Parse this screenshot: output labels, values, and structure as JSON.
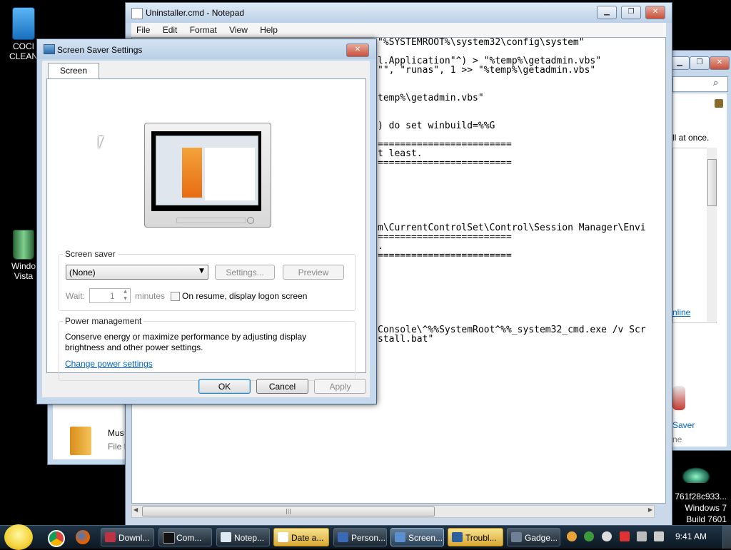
{
  "desktop": {
    "ccleaner_label_1": "COCI",
    "ccleaner_label_2": "CLEAN",
    "bin_label_1": "Windo",
    "bin_label_2": "Vista",
    "watermark_hash": "761f28c933...",
    "watermark_os": "Windows 7",
    "watermark_build": "Build 7601"
  },
  "notepad": {
    "title": "Uninstaller.cmd - Notepad",
    "menu": [
      "File",
      "Edit",
      "Format",
      "View",
      "Help"
    ],
    "lines": [
      "\"%SYSTEMROOT%\\system32\\config\\system\"",
      "",
      "l.Application\"^) > \"%temp%\\getadmin.vbs\"",
      "\"\", \"runas\", 1 >> \"%temp%\\getadmin.vbs\"",
      "",
      "",
      "temp%\\getadmin.vbs\"",
      "",
      "",
      ") do set winbuild=%%G",
      "",
      "========================",
      "t least.",
      "========================",
      "",
      "",
      "",
      "",
      "",
      "",
      "m\\CurrentControlSet\\Control\\Session Manager\\Envi",
      "========================",
      ".",
      "========================",
      "",
      "",
      "",
      "",
      "",
      "",
      "",
      "Console\\^%%SystemRoot^%%_system32_cmd.exe /v Scr",
      "stall.bat\""
    ],
    "scroll_grip": "|||"
  },
  "right_window": {
    "text_all_at_once": "ll at once.",
    "link_online": "nline",
    "saver_text": "Saver",
    "ne_text": "ne"
  },
  "bg_explorer": {
    "item_name": "Mus",
    "item_type": "File f"
  },
  "dialog": {
    "title": "Screen Saver Settings",
    "tab": "Screen Saver",
    "screensaver_group": "Screen saver",
    "selected_saver": "(None)",
    "settings_btn": "Settings...",
    "preview_btn": "Preview",
    "wait_label": "Wait:",
    "wait_value": "1",
    "minutes_label": "minutes",
    "resume_label": "On resume, display logon screen",
    "power_group": "Power management",
    "power_text_1": "Conserve energy or maximize performance by adjusting display",
    "power_text_2": "brightness and other power settings.",
    "power_link": "Change power settings",
    "ok_btn": "OK",
    "cancel_btn": "Cancel",
    "apply_btn": "Apply"
  },
  "taskbar": {
    "buttons": [
      {
        "label": "Downl..."
      },
      {
        "label": "Com..."
      },
      {
        "label": "Notep..."
      },
      {
        "label": "Date a..."
      },
      {
        "label": "Person..."
      },
      {
        "label": "Screen..."
      },
      {
        "label": "Troubl..."
      },
      {
        "label": "Gadge..."
      }
    ],
    "clock": "9:41 AM"
  }
}
